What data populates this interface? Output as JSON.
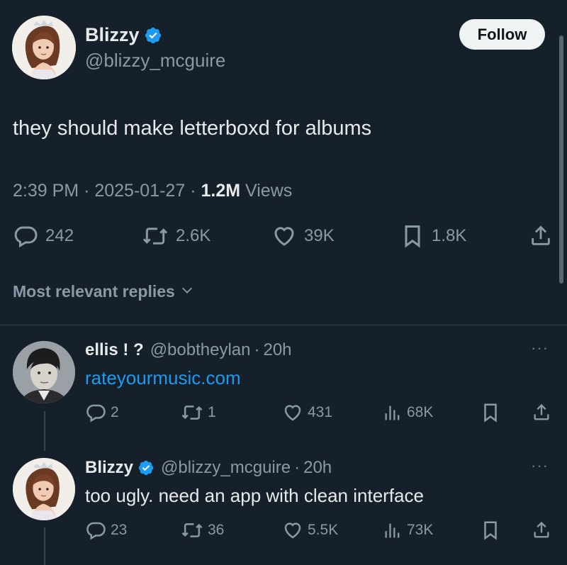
{
  "tweet": {
    "author_name": "Blizzy",
    "author_handle": "@blizzy_mcguire",
    "follow_label": "Follow",
    "text": "they should make letterboxd for albums",
    "time": "2:39 PM",
    "separator": "·",
    "date": "2025-01-27",
    "views_count": "1.2M",
    "views_label": "Views",
    "replies": "242",
    "reposts": "2.6K",
    "likes": "39K",
    "bookmarks": "1.8K"
  },
  "sort": {
    "label": "Most relevant replies"
  },
  "replies": [
    {
      "author_name": "ellis ! ?",
      "author_handle": "@bobtheylan",
      "time_sep": "·",
      "time": "20h",
      "text": "rateyourmusic.com",
      "more": "···",
      "replies": "2",
      "reposts": "1",
      "likes": "431",
      "views": "68K"
    },
    {
      "author_name": "Blizzy",
      "author_handle": "@blizzy_mcguire",
      "time_sep": "·",
      "time": "20h",
      "text": "too ugly. need an app with clean interface",
      "more": "···",
      "replies": "23",
      "reposts": "36",
      "likes": "5.5K",
      "views": "73K"
    }
  ],
  "colors": {
    "background": "#15202b",
    "text": "#e7e9ea",
    "secondary": "#8b98a5",
    "link": "#1d9bf0",
    "verified": "#1d9bf0",
    "follow_bg": "#eff3f4",
    "divider": "#38444d"
  },
  "icons": [
    "verified-badge-icon",
    "reply-icon",
    "repost-icon",
    "like-icon",
    "bookmark-icon",
    "share-icon",
    "views-icon",
    "chevron-down-icon",
    "more-icon"
  ]
}
